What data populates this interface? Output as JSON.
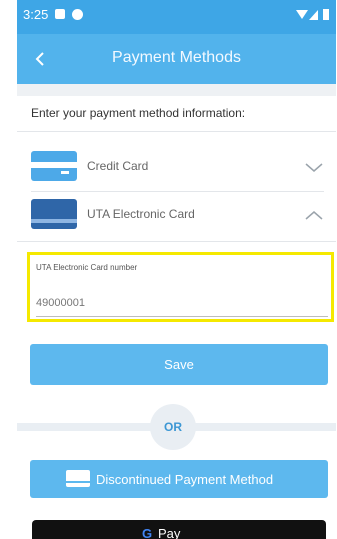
{
  "status": {
    "time": "3:25"
  },
  "appbar": {
    "title": "Payment Methods"
  },
  "intro": "Enter your payment method information:",
  "methods": [
    {
      "label": "Credit Card"
    },
    {
      "label": "UTA Electronic Card"
    }
  ],
  "card_field": {
    "label": "UTA Electronic Card number",
    "value": "49000001"
  },
  "buttons": {
    "save": "Save",
    "or": "OR",
    "discontinued": "Discontinued Payment Method",
    "gpay": "Pay"
  },
  "colors": {
    "primary": "#52b3ec",
    "accent": "#3ea6e6",
    "highlight": "#f5e900"
  }
}
